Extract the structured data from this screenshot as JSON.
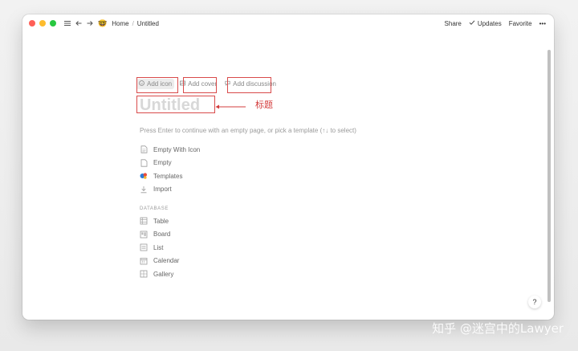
{
  "window": {
    "breadcrumb_home_emoji": "🤓",
    "breadcrumb_home": "Home",
    "breadcrumb_separator": "/",
    "breadcrumb_current": "Untitled"
  },
  "top_actions": {
    "share": "Share",
    "updates": "Updates",
    "favorite": "Favorite",
    "more": "•••"
  },
  "page_actions": {
    "add_icon": "Add icon",
    "add_cover": "Add cover",
    "add_discussion": "Add discussion"
  },
  "title": {
    "placeholder": "Untitled",
    "annotation": "标题"
  },
  "hint": "Press Enter to continue with an empty page, or pick a template (↑↓ to select)",
  "menu": {
    "top_items": [
      {
        "label": "Empty With Icon",
        "icon": "page-with-icon-icon"
      },
      {
        "label": "Empty",
        "icon": "page-icon"
      },
      {
        "label": "Templates",
        "icon": "templates-icon"
      },
      {
        "label": "Import",
        "icon": "import-icon"
      }
    ],
    "section_label": "DATABASE",
    "database_items": [
      {
        "label": "Table",
        "icon": "table-icon"
      },
      {
        "label": "Board",
        "icon": "board-icon"
      },
      {
        "label": "List",
        "icon": "list-icon"
      },
      {
        "label": "Calendar",
        "icon": "calendar-icon"
      },
      {
        "label": "Gallery",
        "icon": "gallery-icon"
      }
    ]
  },
  "help": "?",
  "watermark": "知乎 @迷宫中的Lawyer",
  "colors": {
    "annotation_red": "#d94b4b",
    "traffic_red": "#ff5f57",
    "traffic_yellow": "#febc2e",
    "traffic_green": "#28c840"
  }
}
